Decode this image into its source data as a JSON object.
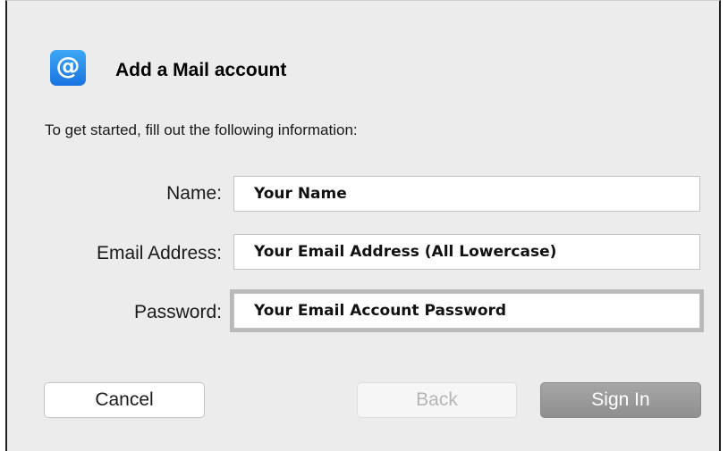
{
  "dialog": {
    "icon_glyph": "@",
    "icon_name": "mail-at-icon",
    "icon_color": "#1a73e0",
    "title": "Add a Mail account",
    "intro": "To get started, fill out the following information:"
  },
  "form": {
    "name": {
      "label": "Name:",
      "value": "Your Name"
    },
    "email": {
      "label": "Email Address:",
      "value": "Your Email Address (All Lowercase)"
    },
    "password": {
      "label": "Password:",
      "value": "Your Email Account Password",
      "focused": true
    }
  },
  "buttons": {
    "cancel": "Cancel",
    "back": "Back",
    "back_enabled": false,
    "sign_in": "Sign In",
    "sign_in_enabled": false
  }
}
